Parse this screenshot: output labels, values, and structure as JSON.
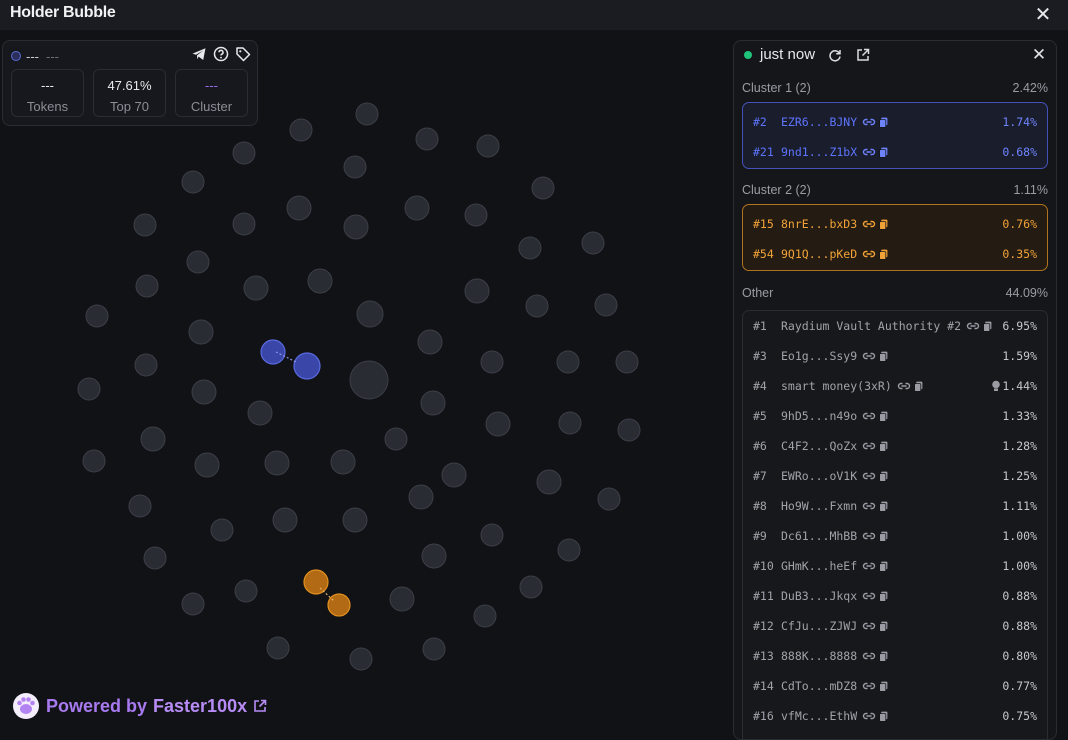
{
  "window": {
    "title": "Holder Bubble",
    "close_icon": "close-icon"
  },
  "stats": {
    "name": "---",
    "sub": "---",
    "boxes": [
      {
        "value": "---",
        "label": "Tokens",
        "color": "#e8e8eb"
      },
      {
        "value": "47.61%",
        "label": "Top 70",
        "color": "#e8e8eb"
      },
      {
        "value": "---",
        "label": "Cluster",
        "color": "#9b6cf0"
      }
    ],
    "icons": [
      "telegram-icon",
      "help-icon",
      "tag-icon"
    ]
  },
  "powered": {
    "prefix": "Powered by",
    "brand": "Faster100x"
  },
  "panel": {
    "updated": "just now",
    "cluster1": {
      "title": "Cluster 1 (2)",
      "pct": "2.42%",
      "rows": [
        {
          "rank": "#2",
          "addr": "EZR6...BJNY",
          "pct": "1.74%"
        },
        {
          "rank": "#21",
          "addr": "9nd1...Z1bX",
          "pct": "0.68%"
        }
      ]
    },
    "cluster2": {
      "title": "Cluster 2 (2)",
      "pct": "1.11%",
      "rows": [
        {
          "rank": "#15",
          "addr": "8nrE...bxD3",
          "pct": "0.76%"
        },
        {
          "rank": "#54",
          "addr": "9Q1Q...pKeD",
          "pct": "0.35%"
        }
      ]
    },
    "other": {
      "title": "Other",
      "pct": "44.09%",
      "rows": [
        {
          "rank": "#1",
          "addr": "Raydium Vault Authority #2",
          "pct": "6.95%"
        },
        {
          "rank": "#3",
          "addr": "Eo1g...Ssy9",
          "pct": "1.59%"
        },
        {
          "rank": "#4",
          "addr": "smart money(3xR)",
          "pct": "1.44%",
          "bulb": true
        },
        {
          "rank": "#5",
          "addr": "9hD5...n49o",
          "pct": "1.33%"
        },
        {
          "rank": "#6",
          "addr": "C4F2...QoZx",
          "pct": "1.28%"
        },
        {
          "rank": "#7",
          "addr": "EWRo...oV1K",
          "pct": "1.25%"
        },
        {
          "rank": "#8",
          "addr": "Ho9W...Fxmn",
          "pct": "1.11%"
        },
        {
          "rank": "#9",
          "addr": "Dc61...MhBB",
          "pct": "1.00%"
        },
        {
          "rank": "#10",
          "addr": "GHmK...heEf",
          "pct": "1.00%"
        },
        {
          "rank": "#11",
          "addr": "DuB3...Jkqx",
          "pct": "0.88%"
        },
        {
          "rank": "#12",
          "addr": "CfJu...ZJWJ",
          "pct": "0.88%"
        },
        {
          "rank": "#13",
          "addr": "888K...8888",
          "pct": "0.80%"
        },
        {
          "rank": "#14",
          "addr": "CdTo...mDZ8",
          "pct": "0.77%"
        },
        {
          "rank": "#16",
          "addr": "vfMc...EthW",
          "pct": "0.75%"
        }
      ]
    }
  },
  "colors": {
    "bubble": "#2a2c33",
    "bubble_stroke": "#3c3f48",
    "cluster1": "#3a46a8",
    "cluster1_stroke": "#5a6ae0",
    "cluster2": "#b26b14",
    "cluster2_stroke": "#e2901f"
  }
}
